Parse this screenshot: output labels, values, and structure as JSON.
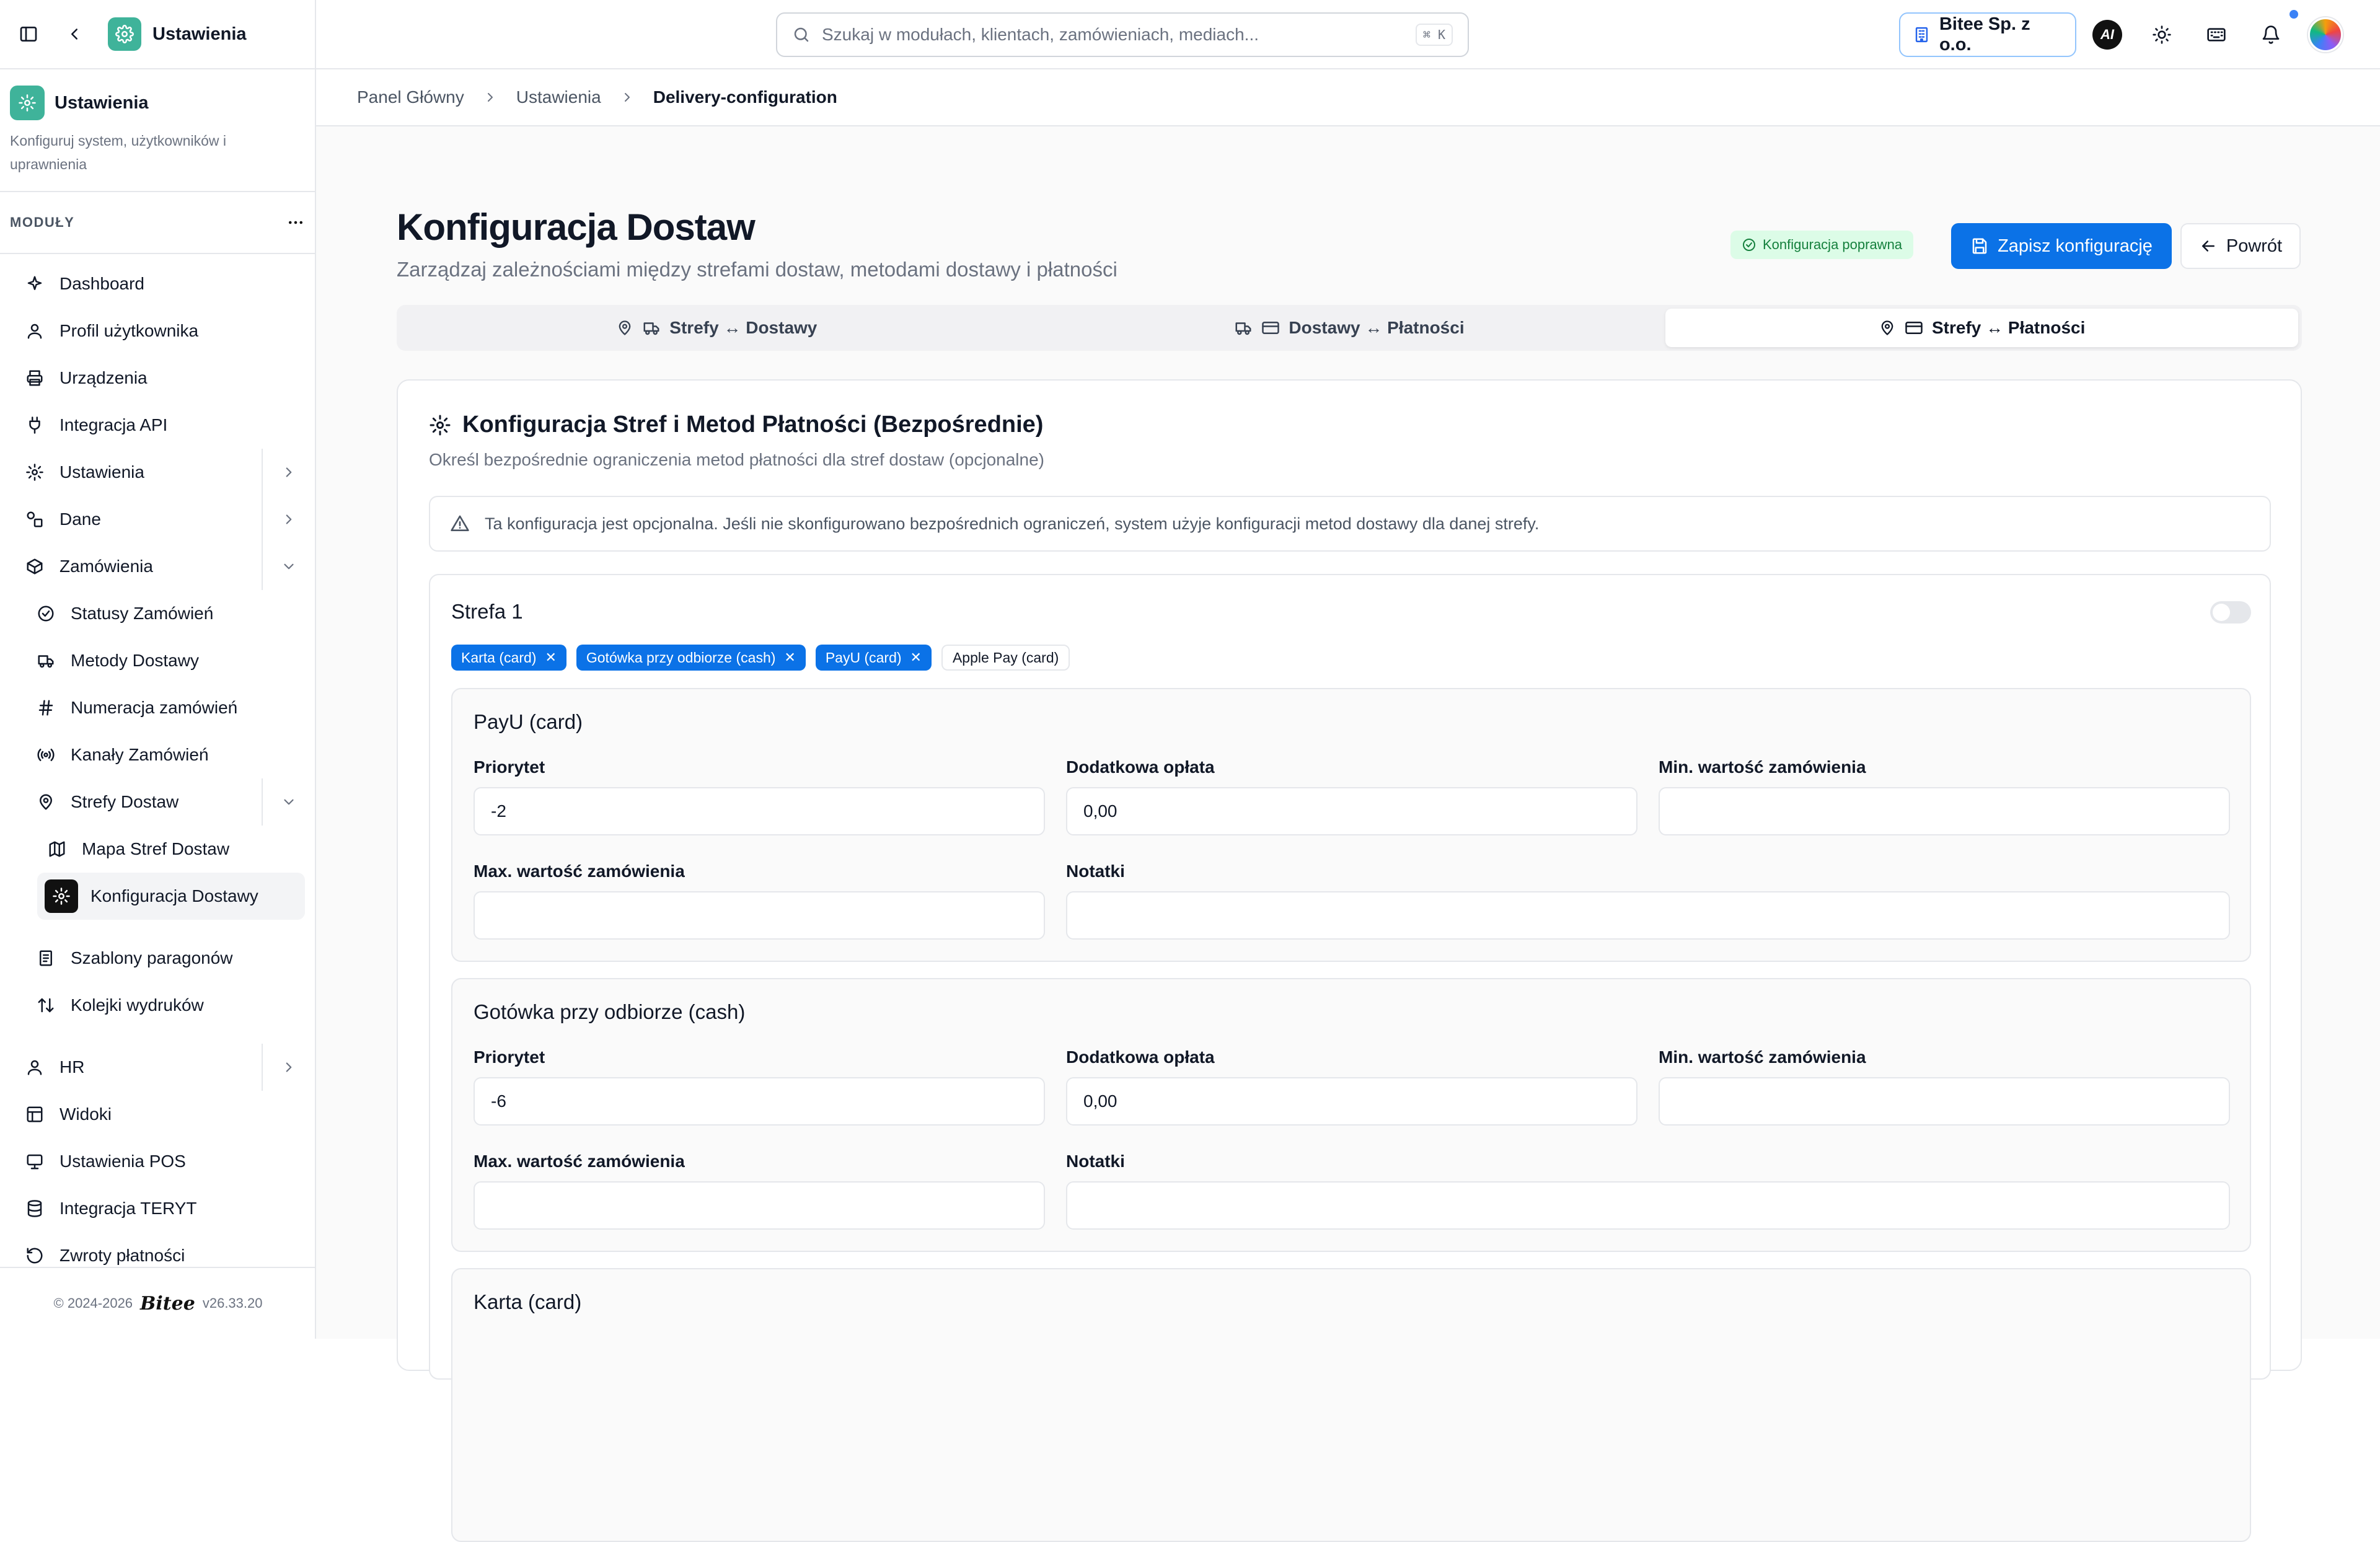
{
  "app": {
    "title": "Ustawienia"
  },
  "sidebar": {
    "title": "Ustawienia",
    "description": "Konfiguruj system, użytkowników i uprawnienia",
    "modules_label": "MODUŁY",
    "items": [
      {
        "label": "Dashboard",
        "icon": "sparkle-icon"
      },
      {
        "label": "Profil użytkownika",
        "icon": "user-icon"
      },
      {
        "label": "Urządzenia",
        "icon": "printer-icon"
      },
      {
        "label": "Integracja API",
        "icon": "plug-icon"
      },
      {
        "label": "Ustawienia",
        "icon": "gear-icon"
      },
      {
        "label": "Dane",
        "icon": "shapes-icon"
      },
      {
        "label": "Zamówienia",
        "icon": "box-icon"
      },
      {
        "label": "Statusy Zamówień",
        "icon": "check-circle-icon"
      },
      {
        "label": "Metody Dostawy",
        "icon": "truck-icon"
      },
      {
        "label": "Numeracja zamówień",
        "icon": "hash-icon"
      },
      {
        "label": "Kanały Zamówień",
        "icon": "broadcast-icon"
      },
      {
        "label": "Strefy Dostaw",
        "icon": "map-pin-icon"
      },
      {
        "label": "Mapa Stref Dostaw",
        "icon": "map-icon"
      },
      {
        "label": "Konfiguracja Dostawy",
        "icon": "gear-icon"
      },
      {
        "label": "Szablony paragonów",
        "icon": "receipt-icon"
      },
      {
        "label": "Kolejki wydruków",
        "icon": "arrows-updown-icon"
      },
      {
        "label": "HR",
        "icon": "user-icon"
      },
      {
        "label": "Widoki",
        "icon": "layout-icon"
      },
      {
        "label": "Ustawienia POS",
        "icon": "monitor-icon"
      },
      {
        "label": "Integracja TERYT",
        "icon": "database-icon"
      },
      {
        "label": "Zwroty płatności",
        "icon": "undo-icon"
      }
    ],
    "footer": {
      "copyright": "© 2024-2026",
      "brand": "Bitee",
      "version": "v26.33.20"
    }
  },
  "topbar": {
    "search_placeholder": "Szukaj w modułach, klientach, zamówieniach, mediach...",
    "shortcut": "⌘ K",
    "company": "Bitee Sp. z o.o.",
    "ai_label": "AI"
  },
  "breadcrumb": [
    "Panel Główny",
    "Ustawienia",
    "Delivery-configuration"
  ],
  "page": {
    "title": "Konfiguracja Dostaw",
    "subtitle": "Zarządzaj zależnościami między strefami dostaw, metodami dostawy i płatności",
    "status_badge": "Konfiguracja poprawna",
    "save_label": "Zapisz konfigurację",
    "back_label": "Powrót",
    "tabs": [
      "Strefy ↔ Dostawy",
      "Dostawy ↔ Płatności",
      "Strefy ↔ Płatności"
    ],
    "selected_tab": "Strefy ↔ Płatności"
  },
  "card": {
    "title": "Konfiguracja Stref i Metod Płatności (Bezpośrednie)",
    "subtitle": "Określ bezpośrednie ograniczenia metod płatności dla stref dostaw (opcjonalne)",
    "alert": "Ta konfiguracja jest opcjonalna. Jeśli nie skonfigurowano bezpośrednich ograniczeń, system użyje konfiguracji metod dostawy dla danej strefy.",
    "zone": {
      "name": "Strefa 1",
      "enabled": false,
      "chips": [
        {
          "label": "Karta (card)",
          "selected": true
        },
        {
          "label": "Gotówka przy odbiorze (cash)",
          "selected": true
        },
        {
          "label": "PayU (card)",
          "selected": true
        },
        {
          "label": "Apple Pay (card)",
          "selected": false
        }
      ],
      "labels": {
        "priority": "Priorytet",
        "fee": "Dodatkowa opłata",
        "min": "Min. wartość zamówienia",
        "max": "Max. wartość zamówienia",
        "notes": "Notatki"
      },
      "methods": [
        {
          "title": "PayU (card)",
          "priority": "-2",
          "fee": "0,00",
          "min": "",
          "max": "",
          "notes": ""
        },
        {
          "title": "Gotówka przy odbiorze (cash)",
          "priority": "-6",
          "fee": "0,00",
          "min": "",
          "max": "",
          "notes": ""
        },
        {
          "title": "Karta (card)"
        }
      ]
    }
  },
  "colors": {
    "accent": "#0b72e7",
    "brand": "#3fb39a",
    "success_bg": "#dcfce7",
    "success_text": "#15803d"
  }
}
